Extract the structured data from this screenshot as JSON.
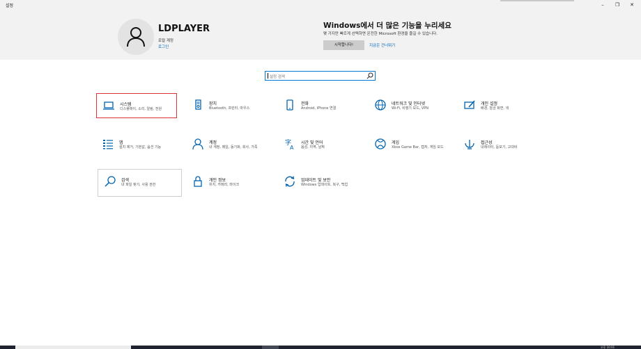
{
  "window": {
    "title": "설정",
    "controls": {
      "minimize": "–",
      "maximize": "❐",
      "close": "✕"
    }
  },
  "account": {
    "name": "LDPLAYER",
    "type": "로컬 계정",
    "login_link": "로그인",
    "avatar_icon": "person-icon"
  },
  "promo": {
    "title": "Windows에서 더 많은 기능을 누리세요",
    "description": "몇 가지만 빠르게 선택하면 온전한 Microsoft 환경을 즐길 수 있습니다.",
    "start_button": "시작합니다!",
    "skip_link": "지금은 건너뛰기"
  },
  "search": {
    "placeholder": "설정 검색",
    "icon": "search-icon"
  },
  "categories": [
    {
      "id": "system",
      "icon": "laptop-icon",
      "title": "시스템",
      "description": "디스플레이, 소리, 알림, 전원"
    },
    {
      "id": "devices",
      "icon": "devices-icon",
      "title": "장치",
      "description": "Bluetooth, 프린터, 마우스"
    },
    {
      "id": "phone",
      "icon": "phone-icon",
      "title": "전화",
      "description": "Android, iPhone 연결"
    },
    {
      "id": "network",
      "icon": "globe-icon",
      "title": "네트워크 및 인터넷",
      "description": "Wi-Fi, 비행기 모드, VPN"
    },
    {
      "id": "personalization",
      "icon": "brush-icon",
      "title": "개인 설정",
      "description": "배경, 잠금 화면, 색"
    },
    {
      "id": "apps",
      "icon": "apps-list-icon",
      "title": "앱",
      "description": "설치 제거, 기본값, 옵션 기능"
    },
    {
      "id": "accounts",
      "icon": "person-icon",
      "title": "계정",
      "description": "내 계정, 메일, 동기화, 회사, 가족"
    },
    {
      "id": "time-language",
      "icon": "language-icon",
      "title": "시간 및 언어",
      "description": "음성, 지역, 날짜"
    },
    {
      "id": "gaming",
      "icon": "xbox-icon",
      "title": "게임",
      "description": "Xbox Game Bar, 캡처, 게임 모드"
    },
    {
      "id": "ease-of-access",
      "icon": "accessibility-icon",
      "title": "접근성",
      "description": "내레이터, 돋보기, 고대비"
    },
    {
      "id": "search",
      "icon": "search-icon",
      "title": "검색",
      "description": "내 파일 찾기, 사용 권한"
    },
    {
      "id": "privacy",
      "icon": "lock-icon",
      "title": "개인 정보",
      "description": "위치, 카메라, 마이크"
    },
    {
      "id": "update-security",
      "icon": "refresh-icon",
      "title": "업데이트 및 보안",
      "description": "Windows 업데이트, 복구, 백업"
    }
  ],
  "taskbar": {
    "clock": "오후 10:01"
  },
  "colors": {
    "accent": "#0078d7",
    "selection": "#e0303a",
    "header_bg": "#f2f2f2"
  }
}
